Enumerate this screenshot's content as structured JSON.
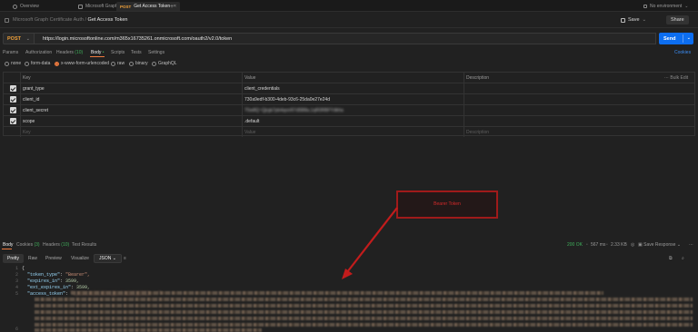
{
  "tabs": [
    {
      "label": "Overview",
      "icon": "database-icon"
    },
    {
      "label": "Microsoft Graph",
      "icon": "collection-icon"
    },
    {
      "method": "POST",
      "label": "Get Access Token",
      "active": true
    }
  ],
  "env": {
    "label": "No environment"
  },
  "breadcrumb": {
    "parent": "Microsoft Graph Certificate Auth",
    "separator": "/",
    "current": "Get Access Token"
  },
  "actions": {
    "save": "Save",
    "share": "Share"
  },
  "request": {
    "method": "POST",
    "url": "https://login.microsoftonline.com/m365x16735261.onmicrosoft.com/oauth2/v2.0/token",
    "send": "Send"
  },
  "req_tabs": [
    {
      "label": "Params"
    },
    {
      "label": "Authorization"
    },
    {
      "label": "Headers",
      "count": "(10)"
    },
    {
      "label": "Body",
      "active": true
    },
    {
      "label": "Scripts"
    },
    {
      "label": "Tests"
    },
    {
      "label": "Settings"
    }
  ],
  "cookies_link": "Cookies",
  "body_types": [
    "none",
    "form-data",
    "x-www-form-urlencoded",
    "raw",
    "binary",
    "GraphQL"
  ],
  "body_selected": "x-www-form-urlencoded",
  "table": {
    "headers": {
      "key": "Key",
      "value": "Value",
      "description": "Description",
      "bulk": "Bulk Edit"
    },
    "rows": [
      {
        "key": "grant_type",
        "value": "client_credentials"
      },
      {
        "key": "client_id",
        "value": "730a9edf-b300-4deb-93c6-25da0e27e24d"
      },
      {
        "key": "client_secret",
        "value": "T5w8Q~Qjrgk7pb4qonR7d5B8a.1qR0RBFYdkha"
      },
      {
        "key": "scope",
        "value": ".default"
      }
    ],
    "placeholder": {
      "key": "Key",
      "value": "Value",
      "description": "Description"
    }
  },
  "annotation": {
    "label": "Bearer Token",
    "color": "#a01a1a"
  },
  "response": {
    "tabs": [
      {
        "label": "Body",
        "active": true
      },
      {
        "label": "Cookies",
        "count": "(3)"
      },
      {
        "label": "Headers",
        "count": "(10)"
      },
      {
        "label": "Test Results"
      }
    ],
    "status": "200 OK",
    "time": "567 ms",
    "size": "2.33 KB",
    "save": "Save Response",
    "views": [
      "Pretty",
      "Raw",
      "Preview",
      "Visualize"
    ],
    "format": "JSON",
    "lines": [
      "1",
      "2",
      "3",
      "4",
      "5",
      "6"
    ],
    "json": {
      "open": "{",
      "token_type_key": "\"token_type\"",
      "token_type_val": "\"Bearer\",",
      "expires_in_key": "\"expires_in\"",
      "expires_in_val": "3599,",
      "ext_expires_in_key": "\"ext_expires_in\"",
      "ext_expires_in_val": "3599,",
      "access_token_key": "\"access_token\"",
      "access_token_val": "\"eyJ0eXAiOiJKV1QiLCJub25jZSI6...\""
    }
  },
  "colors": {
    "accent": "#f07b3f",
    "send": "#0d6ef0",
    "post": "#f2a23a",
    "ok": "#3fae5a"
  }
}
